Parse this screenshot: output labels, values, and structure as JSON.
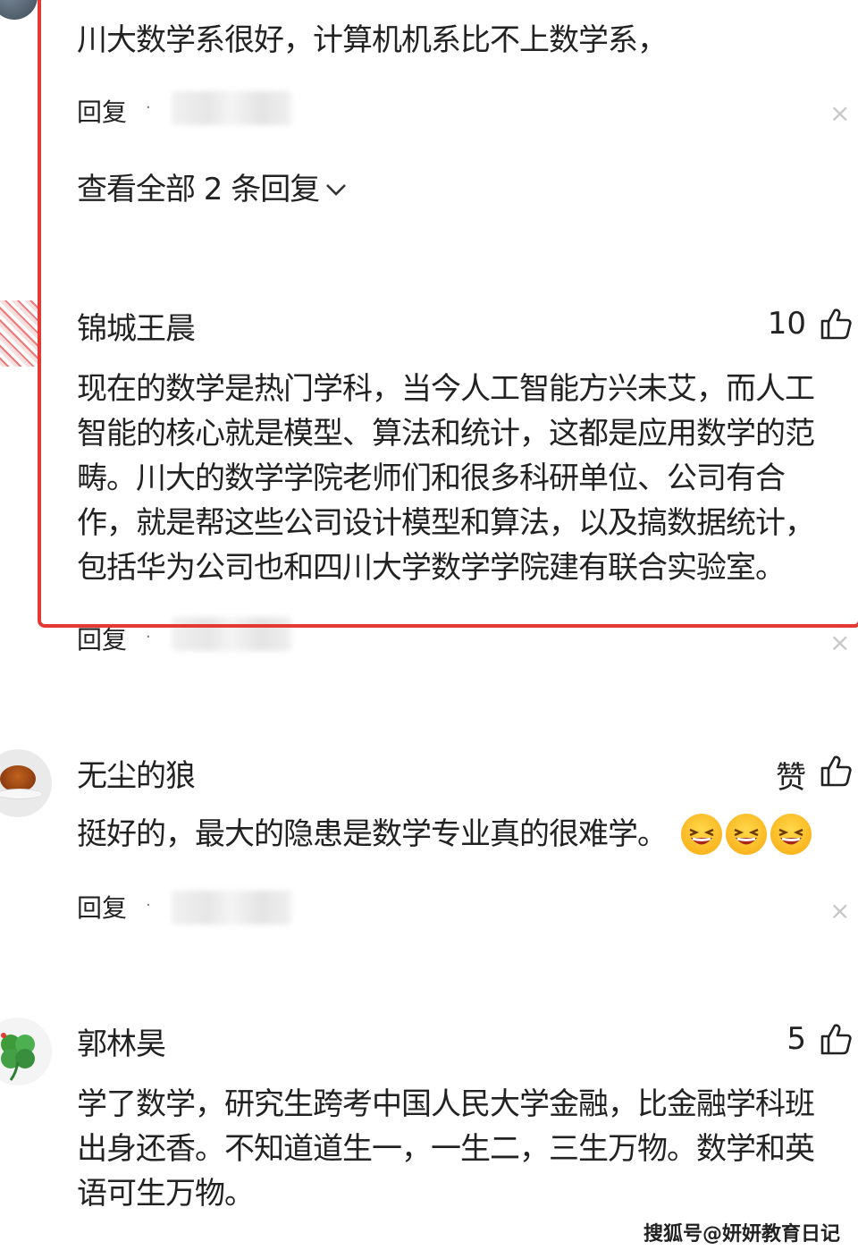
{
  "comments": [
    {
      "text": "川大数学系很好，计算机机系比不上数学系，",
      "reply_label": "回复",
      "view_all_label": "查看全部 2 条回复"
    },
    {
      "username": "锦城王晨",
      "likes": "10",
      "lines": [
        "现在的数学是热门学科，当今人工智能方兴未艾，而人工",
        "智能的核心就是模型、算法和统计，这都是应用数学的范",
        "畴。川大的数学学院老师们和很多科研单位、公司有合",
        "作，就是帮这些公司设计模型和算法，以及搞数据统计，",
        "包括华为公司也和四川大学数学学院建有联合实验室。"
      ],
      "reply_label": "回复"
    },
    {
      "username": "无尘的狼",
      "likes": "赞",
      "text": "挺好的，最大的隐患是数学专业真的很难学。",
      "emojis": [
        "laughing-emoji",
        "laughing-emoji",
        "laughing-emoji"
      ],
      "reply_label": "回复"
    },
    {
      "username": "郭林昊",
      "likes": "5",
      "lines": [
        "学了数学，研究生跨考中国人民大学金融，比金融学科班",
        "出身还香。不知道道生一，一生二，三生万物。数学和英",
        "语可生万物。"
      ]
    }
  ],
  "separator": "·",
  "close_symbol": "×",
  "watermark": "搜狐号@妍妍教育日记",
  "highlight_color": "#e53935"
}
